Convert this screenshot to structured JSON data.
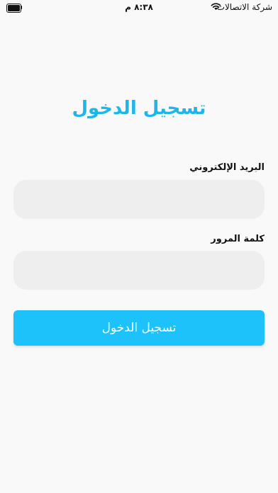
{
  "status_bar": {
    "time": "٨:٣٨ م",
    "carrier": "شركة الاتصالات"
  },
  "login": {
    "title": "تسجيل الدخول",
    "email_label": "البريد الإلكتروني",
    "email_value": "",
    "password_label": "كلمة المرور",
    "password_value": "",
    "submit_label": "تسجيل الدخول"
  },
  "colors": {
    "accent": "#1cb6ea",
    "button": "#1ec2fa",
    "field_bg": "#eeeeee",
    "page_bg": "#f9f9f9"
  },
  "icons": [
    "battery-icon",
    "wifi-icon"
  ]
}
